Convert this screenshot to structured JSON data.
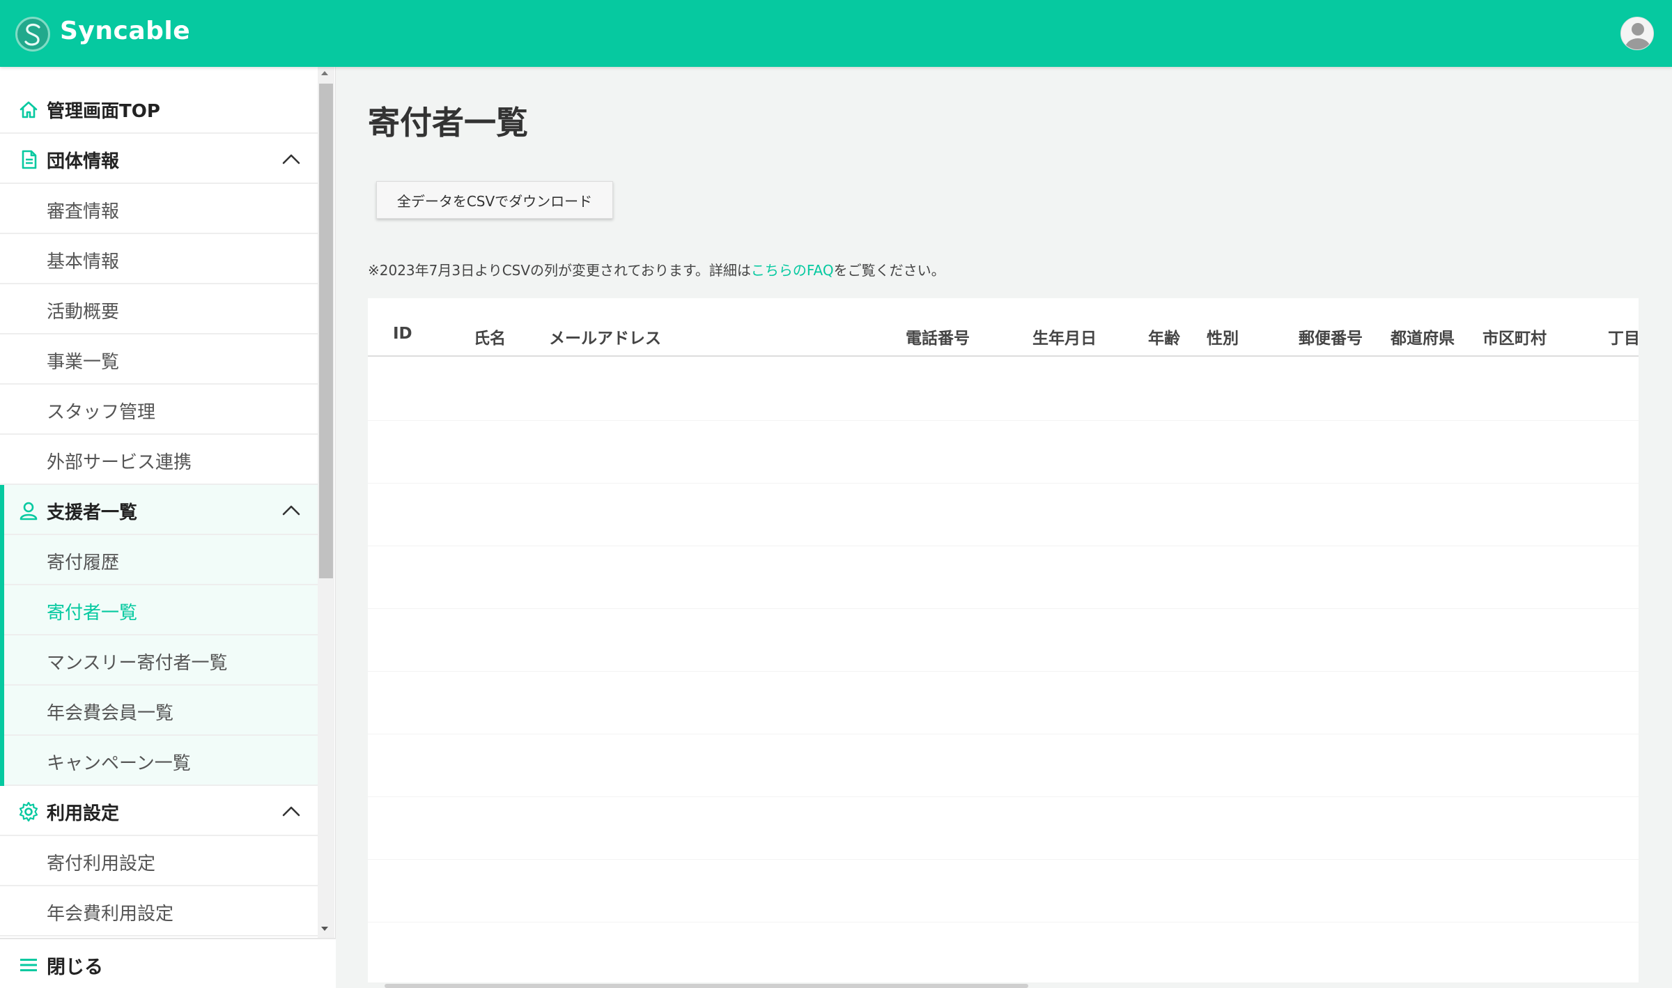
{
  "app": {
    "name": "Syncable"
  },
  "sidebar": {
    "items": [
      {
        "label": "管理画面TOP",
        "icon": "home-icon",
        "type": "top"
      },
      {
        "label": "団体情報",
        "icon": "document-icon",
        "type": "group"
      },
      {
        "label": "審査情報",
        "type": "sub"
      },
      {
        "label": "基本情報",
        "type": "sub"
      },
      {
        "label": "活動概要",
        "type": "sub"
      },
      {
        "label": "事業一覧",
        "type": "sub"
      },
      {
        "label": "スタッフ管理",
        "type": "sub"
      },
      {
        "label": "外部サービス連携",
        "type": "sub"
      },
      {
        "label": "支援者一覧",
        "icon": "person-icon",
        "type": "group"
      },
      {
        "label": "寄付履歴",
        "type": "sub"
      },
      {
        "label": "寄付者一覧",
        "type": "sub",
        "active": true
      },
      {
        "label": "マンスリー寄付者一覧",
        "type": "sub"
      },
      {
        "label": "年会費会員一覧",
        "type": "sub"
      },
      {
        "label": "キャンペーン一覧",
        "type": "sub"
      },
      {
        "label": "利用設定",
        "icon": "gear-icon",
        "type": "group"
      },
      {
        "label": "寄付利用設定",
        "type": "sub"
      },
      {
        "label": "年会費利用設定",
        "type": "sub"
      }
    ],
    "close_label": "閉じる"
  },
  "main": {
    "title": "寄付者一覧",
    "csv_button": "全データをCSVでダウンロード",
    "notice_prefix": "※2023年7月3日よりCSVの列が変更されております。詳細は",
    "notice_link": "こちらのFAQ",
    "notice_suffix": "をご覧ください。",
    "table": {
      "columns": [
        "ID",
        "氏名",
        "メールアドレス",
        "電話番号",
        "生年月日",
        "年齢",
        "性別",
        "郵便番号",
        "都道府県",
        "市区町村",
        "丁目"
      ],
      "row_count": 10
    }
  },
  "colors": {
    "accent": "#06c9a0",
    "background": "#f2f4f3"
  }
}
